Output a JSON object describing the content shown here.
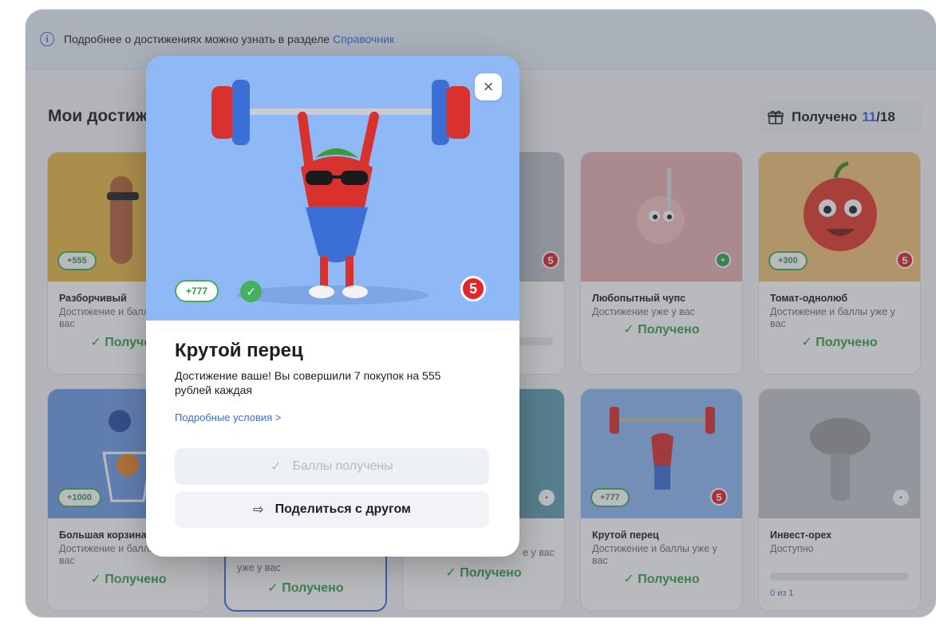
{
  "info": {
    "text": "Подробнее о достижениях можно узнать в разделе",
    "link": "Справочник",
    "icon": "info-icon"
  },
  "section": {
    "title": "Мои достижения",
    "received_label": "Получено",
    "received_count": "11",
    "received_total": "/18"
  },
  "cards": [
    {
      "title": "Разборчивый",
      "sub": "Достижение и баллы уже у вас",
      "status": "✓ Получено",
      "points": "+555"
    },
    {
      "title": "",
      "sub": "",
      "status": "",
      "points": ""
    },
    {
      "title": "Любопытный чупс",
      "sub": "Достижение уже у вас",
      "status": "✓ Получено",
      "points": ""
    },
    {
      "title": "Томат-однолюб",
      "sub": "Достижение и баллы уже у вас",
      "status": "✓ Получено",
      "points": "+300"
    },
    {
      "title": "Большая корзина",
      "sub": "Достижение и баллы уже у вас",
      "status": "✓ Получено",
      "points": "+1000"
    },
    {
      "title": "",
      "sub": "уже у вас",
      "status": "✓ Получено",
      "points": ""
    },
    {
      "title": "",
      "sub": "е у вас",
      "status": "✓ Получено",
      "points": ""
    },
    {
      "title": "Крутой перец",
      "sub": "Достижение и баллы уже у вас",
      "status": "✓ Получено",
      "points": "+777"
    },
    {
      "title": "Инвест-орех",
      "sub": "Доступно",
      "status": "",
      "points": "",
      "progress_current": "0",
      "progress_rest": " из 1",
      "progress_value": 0
    }
  ],
  "modal": {
    "points": "+777",
    "title": "Крутой перец",
    "description": "Достижение ваше! Вы совершили 7 покупок на 555 рублей каждая",
    "details_link": "Подробные условия >",
    "received_button": "Баллы получены",
    "share_button": "Поделиться с другом",
    "close_icon": "×",
    "brand_glyph": "5"
  },
  "colors": {
    "accent": "#2f6fe0",
    "success": "#43b05c",
    "brand": "#e3262c",
    "hero_bg": "#8fb8f6"
  }
}
